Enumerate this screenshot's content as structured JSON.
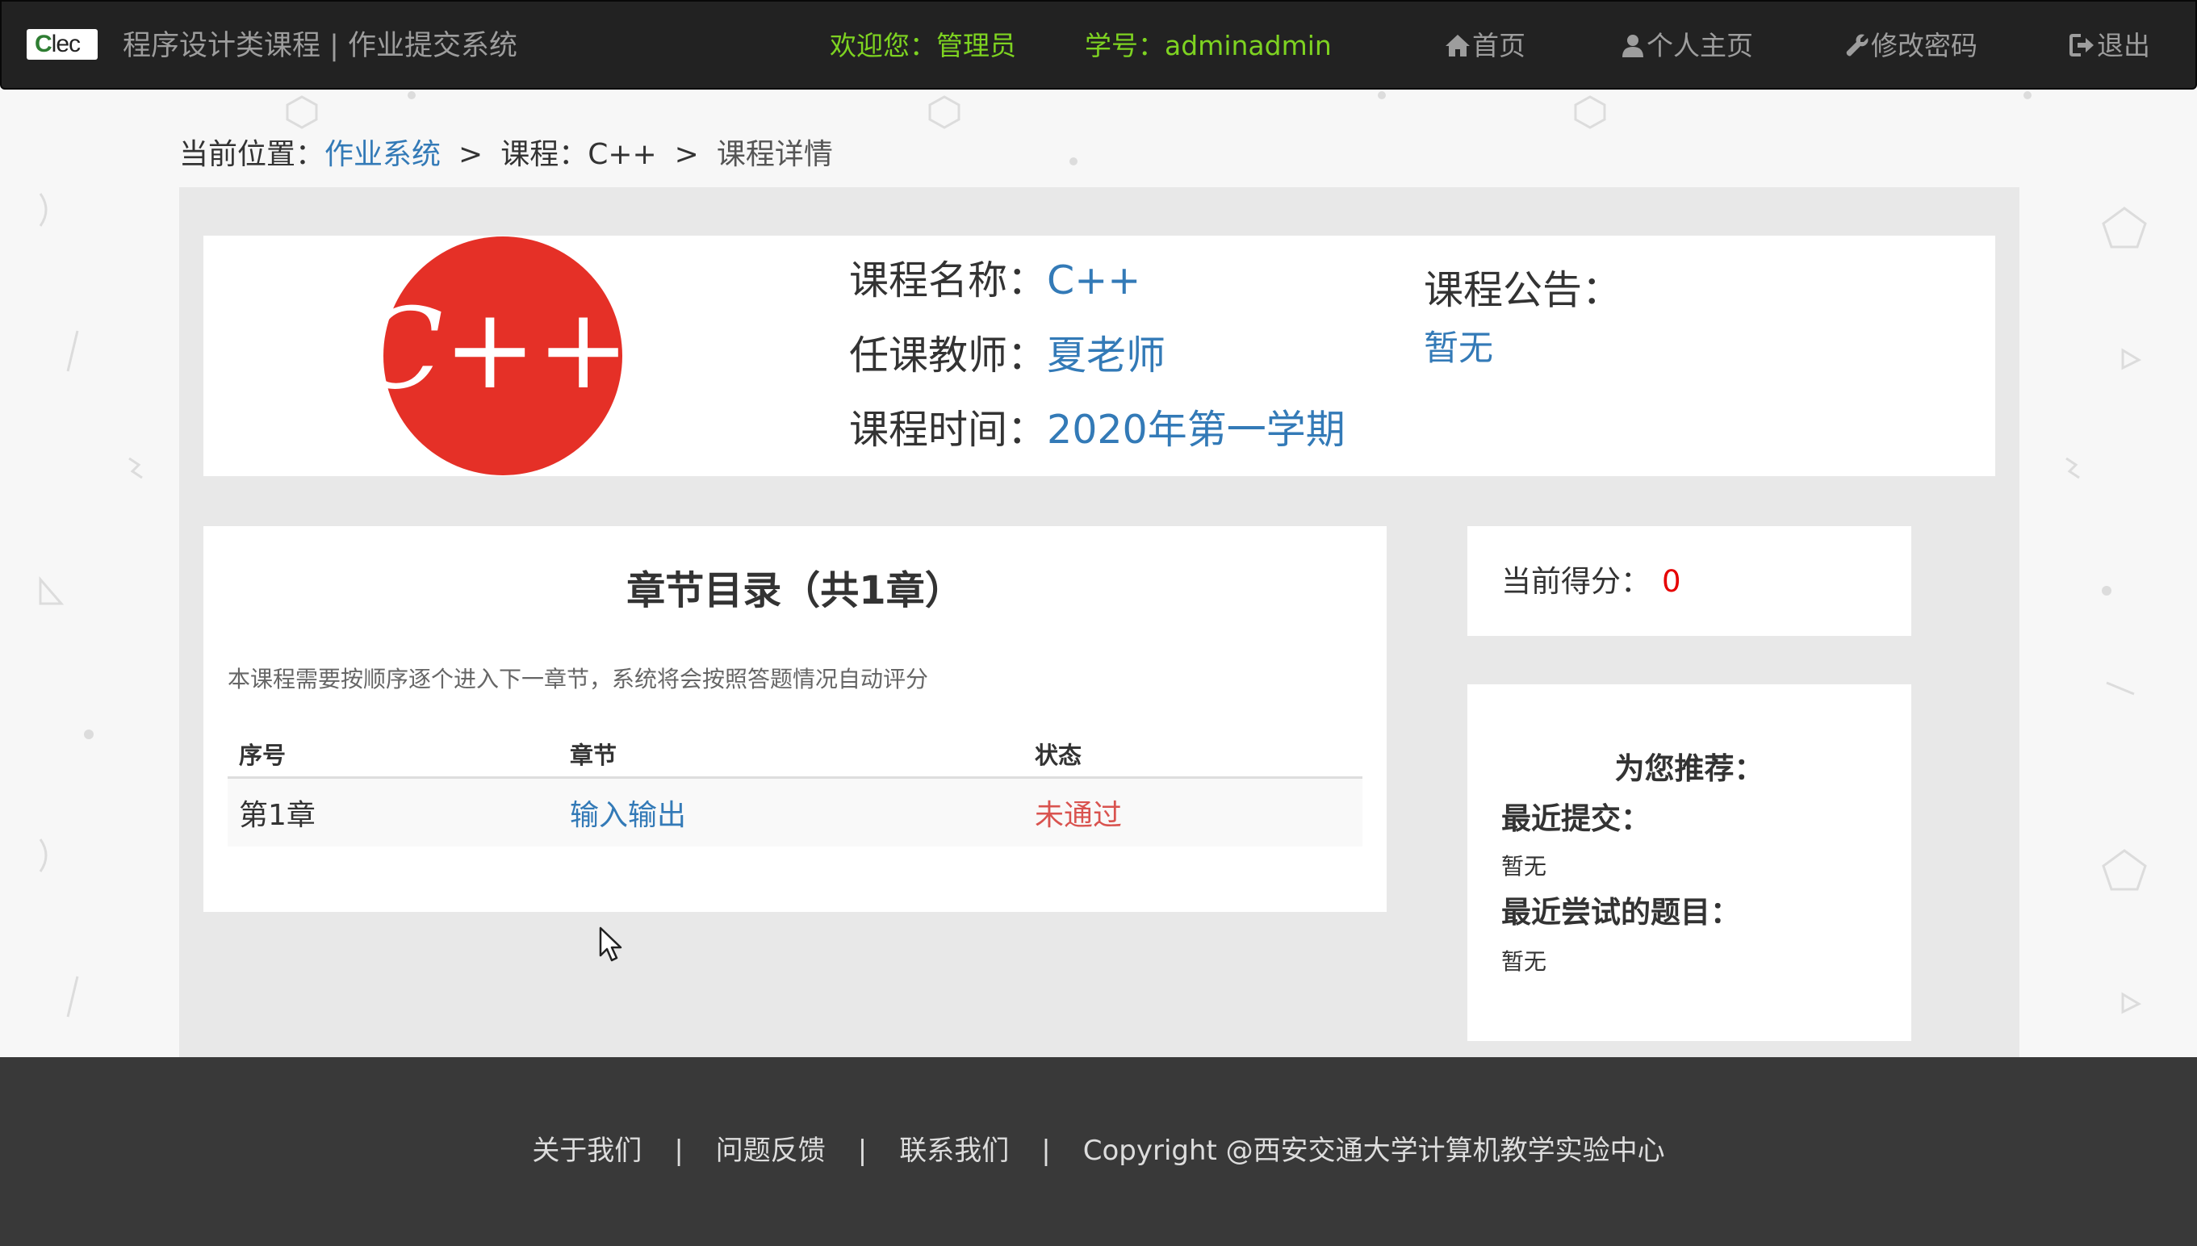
{
  "navbar": {
    "logo_text": "lec",
    "brand": "程序设计类课程 | 作业提交系统",
    "welcome": "欢迎您：管理员",
    "student_no": "学号：adminadmin",
    "links": {
      "home": "首页",
      "profile": "个人主页",
      "password": "修改密码",
      "logout": "退出"
    }
  },
  "breadcrumb": {
    "prefix": "当前位置：",
    "root": "作业系统",
    "separator": ">",
    "course": "课程：C++",
    "current": "课程详情"
  },
  "course": {
    "logo_text": "C++",
    "name_label": "课程名称：",
    "name": "C++",
    "teacher_label": "任课教师：",
    "teacher": "夏老师",
    "time_label": "课程时间：",
    "time": "2020年第一学期",
    "notice_label": "课程公告：",
    "notice": "暂无"
  },
  "chapters": {
    "title": "章节目录（共1章）",
    "note": "本课程需要按顺序逐个进入下一章节，系统将会按照答题情况自动评分",
    "columns": [
      "序号",
      "章节",
      "状态"
    ],
    "rows": [
      {
        "index": "第1章",
        "chapter": "输入输出",
        "status": "未通过"
      }
    ]
  },
  "score": {
    "label": "当前得分：",
    "value": "0"
  },
  "recommend": {
    "title": "为您推荐：",
    "recent_submit_label": "最近提交：",
    "recent_submit_value": "暂无",
    "recent_tried_label": "最近尝试的题目：",
    "recent_tried_value": "暂无"
  },
  "footer": {
    "about": "关于我们",
    "feedback": "问题反馈",
    "contact": "联系我们",
    "separator": "|",
    "copyright": "Copyright @西安交通大学计算机教学实验中心"
  },
  "colors": {
    "navbar_bg": "#222222",
    "accent_green": "#7ed321",
    "link_blue": "#337ab7",
    "fail_red": "#d9534f",
    "score_red": "#e60000",
    "logo_red": "#e53027",
    "footer_bg": "#393939"
  },
  "icons": {
    "home": "home-icon",
    "profile": "user-icon",
    "password": "wrench-icon",
    "logout": "logout-icon"
  }
}
